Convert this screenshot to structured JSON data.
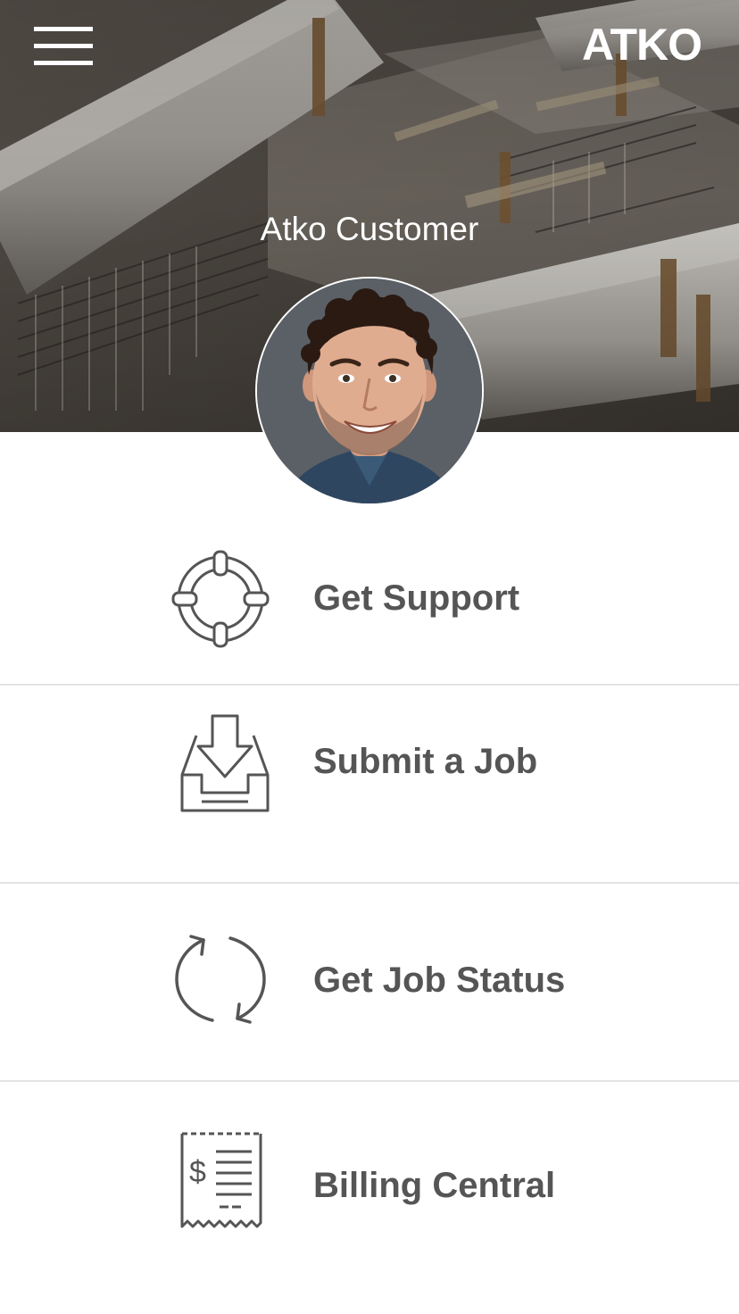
{
  "header": {
    "menu_icon": "hamburger-menu-icon",
    "brand": "ATKO",
    "user_name": "Atko Customer",
    "avatar_icon": "user-avatar-photo"
  },
  "menu": {
    "items": [
      {
        "label": "Get Support",
        "icon": "lifebuoy-icon"
      },
      {
        "label": "Submit a Job",
        "icon": "inbox-download-icon"
      },
      {
        "label": "Get Job Status",
        "icon": "refresh-cycle-icon"
      },
      {
        "label": "Billing Central",
        "icon": "receipt-dollar-icon"
      }
    ]
  },
  "colors": {
    "label_text": "#555555",
    "icon_stroke": "#555555",
    "divider": "#e3e3e3",
    "header_text": "#ffffff"
  }
}
